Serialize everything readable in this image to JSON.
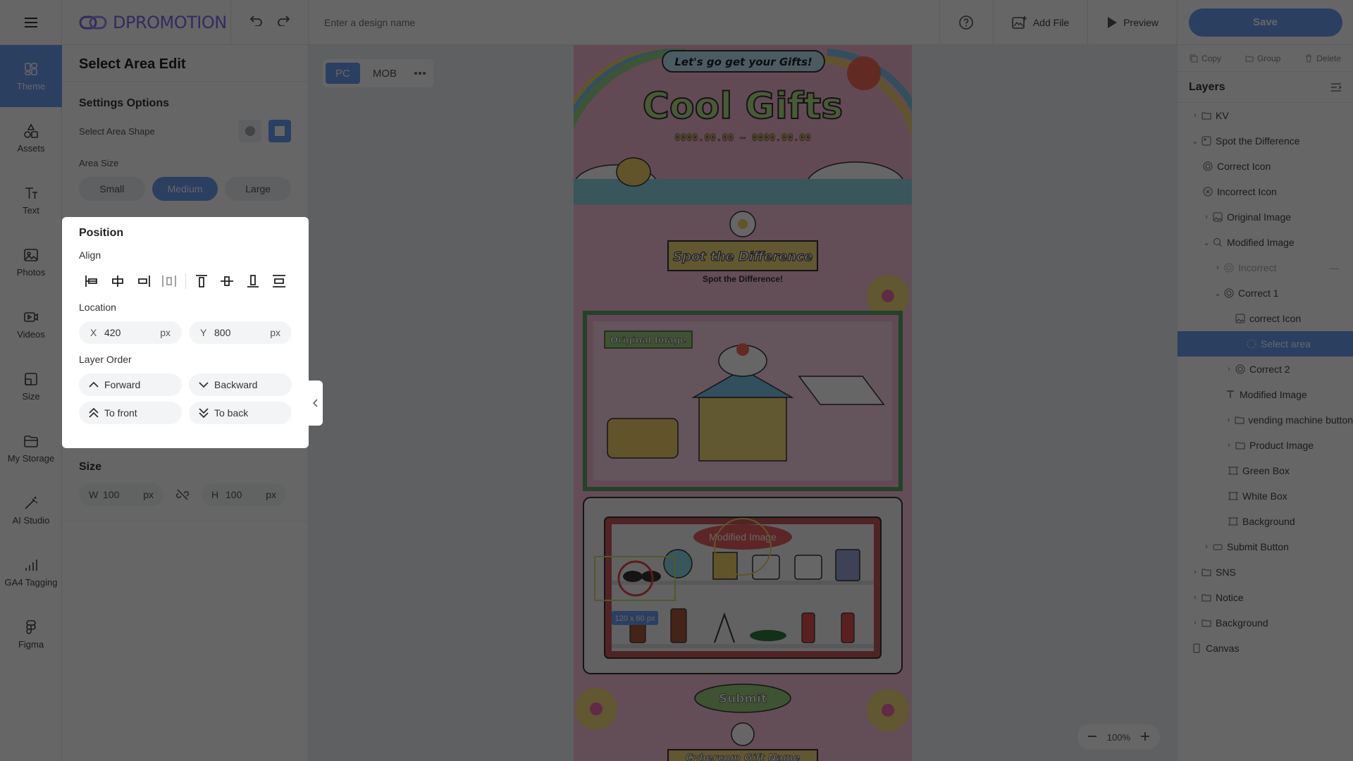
{
  "app": {
    "logo_text": "DPROMOTION",
    "design_name_placeholder": "Enter a design name",
    "add_file": "Add File",
    "preview": "Preview",
    "save": "Save",
    "accent_color": "#6c9ef2"
  },
  "rail": {
    "items": [
      {
        "label": "Theme",
        "icon": "theme-icon"
      },
      {
        "label": "Assets",
        "icon": "assets-icon"
      },
      {
        "label": "Text",
        "icon": "text-icon"
      },
      {
        "label": "Photos",
        "icon": "photo-icon"
      },
      {
        "label": "Videos",
        "icon": "video-icon"
      },
      {
        "label": "Size",
        "icon": "size-icon"
      },
      {
        "label": "My Storage",
        "icon": "folder-icon"
      },
      {
        "label": "AI Studio",
        "icon": "magic-wand-icon"
      },
      {
        "label": "GA4 Tagging",
        "icon": "bar-chart-icon"
      },
      {
        "label": "Figma",
        "icon": "figma-icon"
      }
    ]
  },
  "panel": {
    "title": "Select Area Edit",
    "settings_title": "Settings Options",
    "shape_label": "Select Area Shape",
    "area_size_label": "Area Size",
    "sizes": [
      "Small",
      "Medium",
      "Large"
    ],
    "selected_size": "Medium"
  },
  "position": {
    "title": "Position",
    "align_label": "Align",
    "location_label": "Location",
    "x_axis": "X",
    "x_value": "420",
    "y_axis": "Y",
    "y_value": "800",
    "unit": "px",
    "layer_order_label": "Layer Order",
    "forward": "Forward",
    "backward": "Backward",
    "to_front": "To front",
    "to_back": "To back"
  },
  "size": {
    "title": "Size",
    "w_axis": "W",
    "w_value": "100",
    "h_axis": "H",
    "h_value": "100",
    "unit": "px"
  },
  "workspace": {
    "device_pc": "PC",
    "device_mob": "MOB",
    "zoom": "100%"
  },
  "artboard": {
    "badge": "Let's go get your Gifts!",
    "title": "Cool Gifts",
    "date_range": "0000.00.00 ~ 0000.00.00",
    "banner_title": "Spot the Difference",
    "banner_sub": "Spot the Difference!",
    "original_label": "Original Image",
    "modified_label": "Modified Image",
    "selection_size": "120 x 60 px",
    "submit": "Submit",
    "next_section": "Cybercom Gift Name"
  },
  "right": {
    "copy": "Copy",
    "group": "Group",
    "delete": "Delete",
    "layers_title": "Layers",
    "layers": [
      {
        "label": "KV"
      },
      {
        "label": "Spot the Difference"
      },
      {
        "label": "Correct Icon"
      },
      {
        "label": "Incorrect Icon"
      },
      {
        "label": "Original Image"
      },
      {
        "label": "Modified Image"
      },
      {
        "label": "Incorrect"
      },
      {
        "label": "Correct 1"
      },
      {
        "label": "correct Icon"
      },
      {
        "label": "Select area"
      },
      {
        "label": "Correct 2"
      },
      {
        "label": "Modified Image"
      },
      {
        "label": "vending machine button"
      },
      {
        "label": "Product Image"
      },
      {
        "label": "Green Box"
      },
      {
        "label": "White Box"
      },
      {
        "label": "Background"
      },
      {
        "label": "Submit Button"
      },
      {
        "label": "SNS"
      },
      {
        "label": "Notice"
      },
      {
        "label": "Background"
      },
      {
        "label": "Canvas"
      }
    ]
  }
}
